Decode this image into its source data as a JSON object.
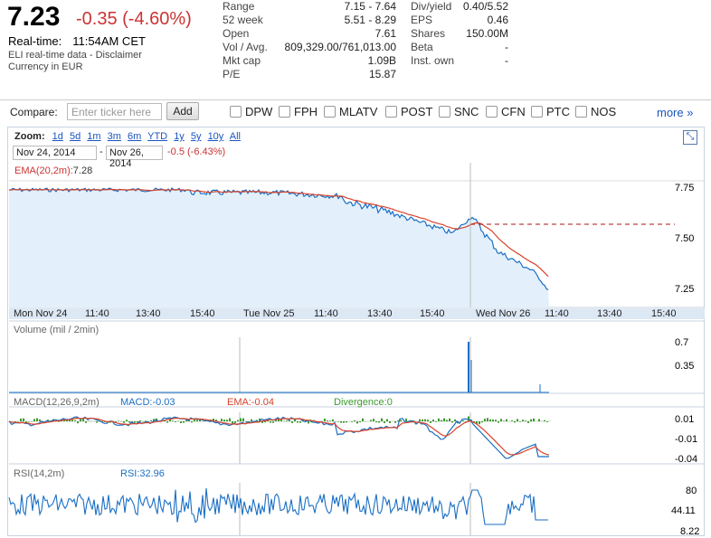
{
  "quote": {
    "price": "7.23",
    "change": "-0.35 (-4.60%)",
    "realtime_label": "Real-time:",
    "realtime_time": "11:54AM CET",
    "disclaimer": "ELI real-time data - Disclaimer",
    "currency": "Currency in EUR"
  },
  "stats_col1": [
    {
      "label": "Range",
      "value": "7.15 - 7.64"
    },
    {
      "label": "52 week",
      "value": "5.51 - 8.29"
    },
    {
      "label": "Open",
      "value": "7.61"
    },
    {
      "label": "Vol / Avg.",
      "value": "809,329.00/761,013.00"
    },
    {
      "label": "Mkt cap",
      "value": "1.09B"
    },
    {
      "label": "P/E",
      "value": "15.87"
    }
  ],
  "stats_col2": [
    {
      "label": "Div/yield",
      "value": "0.40/5.52"
    },
    {
      "label": "EPS",
      "value": "0.46"
    },
    {
      "label": "Shares",
      "value": "150.00M"
    },
    {
      "label": "Beta",
      "value": "-"
    },
    {
      "label": "Inst. own",
      "value": "-"
    }
  ],
  "compare": {
    "label": "Compare:",
    "placeholder": "Enter ticker here",
    "add_label": "Add",
    "tickers": [
      "DPW",
      "FPH",
      "MLATV",
      "POST",
      "SNC",
      "CFN",
      "PTC",
      "NOS"
    ],
    "more_label": "more »"
  },
  "zoom": {
    "label": "Zoom:",
    "options": [
      "1d",
      "5d",
      "1m",
      "3m",
      "6m",
      "YTD",
      "1y",
      "5y",
      "10y",
      "All"
    ],
    "start_date": "Nov 24, 2014",
    "dash": "-",
    "end_date": "Nov 26, 2014",
    "change": "-0.5 (-6.43%)"
  },
  "price_panel": {
    "ema_label": "EMA(20,2m):",
    "ema_value": "7.28",
    "y_ticks": [
      "7.75",
      "7.50",
      "7.25"
    ]
  },
  "x_axis": [
    "Mon Nov 24",
    "11:40",
    "13:40",
    "15:40",
    "Tue Nov 25",
    "11:40",
    "13:40",
    "15:40",
    "Wed Nov 26",
    "11:40",
    "13:40",
    "15:40"
  ],
  "volume_panel": {
    "label": "Volume (mil / 2min)",
    "y_ticks": [
      "0.7",
      "0.35"
    ]
  },
  "macd_panel": {
    "label": "MACD(12,26,9,2m)",
    "macd": "MACD:-0.03",
    "ema": "EMA:-0.04",
    "divergence": "Divergence:0",
    "y_ticks": [
      "0.01",
      "-0.01",
      "-0.04"
    ]
  },
  "rsi_panel": {
    "label": "RSI(14,2m)",
    "rsi": "RSI:32.96",
    "y_ticks": [
      "80",
      "44.11",
      "8.22"
    ]
  },
  "colors": {
    "price_line": "#1a6fc4",
    "price_fill": "#e3f0fb",
    "ema_line": "#d9432b",
    "down": "#cc3333",
    "link": "#1a55c0",
    "macd_bar": "#3c9b2e"
  }
}
